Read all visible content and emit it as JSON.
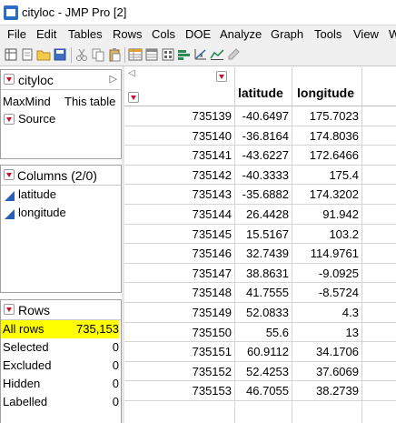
{
  "window": {
    "title": "cityloc - JMP Pro [2]"
  },
  "menu": [
    "File",
    "Edit",
    "Tables",
    "Rows",
    "Cols",
    "DOE",
    "Analyze",
    "Graph",
    "Tools",
    "View",
    "W"
  ],
  "toolbar": {
    "icons": [
      "new-table-icon",
      "open-icon",
      "open-folder-icon",
      "save-icon",
      "cut-icon",
      "copy-icon",
      "paste-icon",
      "data-table-icon",
      "subset-icon",
      "summary-icon",
      "distribution-icon",
      "fit-model-icon",
      "graph-builder-icon",
      "edit-icon"
    ]
  },
  "table_panel": {
    "name": "cityloc",
    "items": [
      {
        "label": "MaxMind",
        "value": "This table"
      },
      {
        "label": "Source",
        "value": ""
      }
    ]
  },
  "columns_panel": {
    "title": "Columns (2/0)",
    "columns": [
      "latitude",
      "longitude"
    ]
  },
  "rows_panel": {
    "title": "Rows",
    "stats": [
      {
        "label": "All rows",
        "value": "735,153"
      },
      {
        "label": "Selected",
        "value": "0"
      },
      {
        "label": "Excluded",
        "value": "0"
      },
      {
        "label": "Hidden",
        "value": "0"
      },
      {
        "label": "Labelled",
        "value": "0"
      }
    ]
  },
  "grid": {
    "headers": [
      "latitude",
      "longitude"
    ],
    "rows": [
      {
        "row": "735139",
        "latitude": "-40.6497",
        "longitude": "175.7023"
      },
      {
        "row": "735140",
        "latitude": "-36.8164",
        "longitude": "174.8036"
      },
      {
        "row": "735141",
        "latitude": "-43.6227",
        "longitude": "172.6466"
      },
      {
        "row": "735142",
        "latitude": "-40.3333",
        "longitude": "175.4"
      },
      {
        "row": "735143",
        "latitude": "-35.6882",
        "longitude": "174.3202"
      },
      {
        "row": "735144",
        "latitude": "26.4428",
        "longitude": "91.942"
      },
      {
        "row": "735145",
        "latitude": "15.5167",
        "longitude": "103.2"
      },
      {
        "row": "735146",
        "latitude": "32.7439",
        "longitude": "114.9761"
      },
      {
        "row": "735147",
        "latitude": "38.8631",
        "longitude": "-9.0925"
      },
      {
        "row": "735148",
        "latitude": "41.7555",
        "longitude": "-8.5724"
      },
      {
        "row": "735149",
        "latitude": "52.0833",
        "longitude": "4.3"
      },
      {
        "row": "735150",
        "latitude": "55.6",
        "longitude": "13"
      },
      {
        "row": "735151",
        "latitude": "60.9112",
        "longitude": "34.1706"
      },
      {
        "row": "735152",
        "latitude": "52.4253",
        "longitude": "37.6069"
      },
      {
        "row": "735153",
        "latitude": "46.7055",
        "longitude": "38.2739"
      }
    ]
  },
  "colors": {
    "highlight": "#ffff00",
    "red_triangle": "#c8102e",
    "column_icon": "#2b5fb4"
  }
}
